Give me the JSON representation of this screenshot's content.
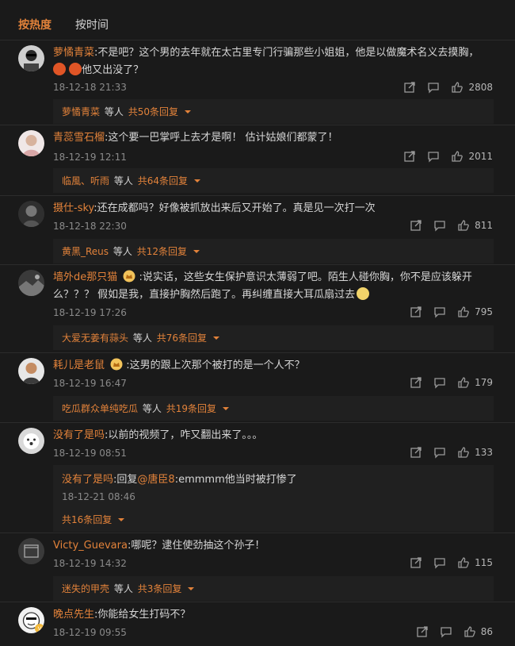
{
  "tabs": {
    "hot": "按热度",
    "time": "按时间"
  },
  "comments": [
    {
      "username": "萝憰青菜",
      "text": "不是吧？这个男的去年就在太古里专门行骗那些小姐姐，他是以做魔术名义去摸胸，",
      "text2": "他又出没了？",
      "date": "18-12-18 21:33",
      "likes": "2808",
      "replies": {
        "users": "萝憰青菜",
        "mid": "等人",
        "count": "共50条回复"
      },
      "avatar": "avatar-glasses-man",
      "emoji": "angry-emoji"
    },
    {
      "username": "青蕊雪石榴",
      "text": "这个要一巴掌呼上去才是啊！ 估计姑娘们都蒙了！",
      "date": "18-12-19 12:11",
      "likes": "2011",
      "replies": {
        "users": "临風、听雨",
        "mid": "等人",
        "count": "共64条回复"
      },
      "avatar": "avatar-woman"
    },
    {
      "username": "摄仕-sky",
      "text": "还在成都吗？好像被抓放出来后又开始了。真是见一次打一次",
      "date": "18-12-18 22:30",
      "likes": "811",
      "replies": {
        "users": "黄黑_Reus",
        "mid": "等人",
        "count": "共12条回复"
      },
      "avatar": "avatar-man-dark"
    },
    {
      "username": "墙外de那只猫",
      "text": "说实话，这些女生保护意识太薄弱了吧。陌生人碰你胸，你不是应该躲开",
      "text2": "么？？？ 假如是我，直接护胸然后跑了。再纠缠直接大耳瓜扇过去",
      "date": "18-12-19 17:26",
      "likes": "795",
      "replies": {
        "users": "大爱无姜有蒜头",
        "mid": "等人",
        "count": "共76条回复"
      },
      "avatar": "avatar-landscape",
      "badge": "crown-badge"
    },
    {
      "username": "耗儿是老鼠",
      "text": "这男的跟上次那个被打的是一个人不？",
      "date": "18-12-19 16:47",
      "likes": "179",
      "replies": {
        "users": "吃瓜群众单纯吃瓜",
        "mid": "等人",
        "count": "共19条回复"
      },
      "avatar": "avatar-young-man",
      "badge": "crown-badge"
    },
    {
      "username": "没有了是吗",
      "text": "以前的视频了，咋又翻出来了。。。",
      "date": "18-12-19 08:51",
      "likes": "133",
      "reply_item": {
        "user": "没有了是吗",
        "prefix": "回复",
        "mention": "@唐臣8",
        "text": "emmmm他当时被打惨了",
        "date": "18-12-21 08:46"
      },
      "replies": {
        "count": "共16条回复"
      },
      "avatar": "avatar-dog"
    },
    {
      "username": "Victy_Guevara",
      "text": "哪呢？逮住使劲抽这个孙子！",
      "date": "18-12-19 14:32",
      "likes": "115",
      "replies": {
        "users": "迷失的甲壳",
        "mid": "等人",
        "count": "共3条回复"
      },
      "avatar": "avatar-book"
    },
    {
      "username": "晚点先生",
      "text": "你能给女生打码不？",
      "date": "18-12-19 09:55",
      "likes": "86",
      "avatar": "avatar-cartoon",
      "badge": "vip-badge"
    }
  ]
}
